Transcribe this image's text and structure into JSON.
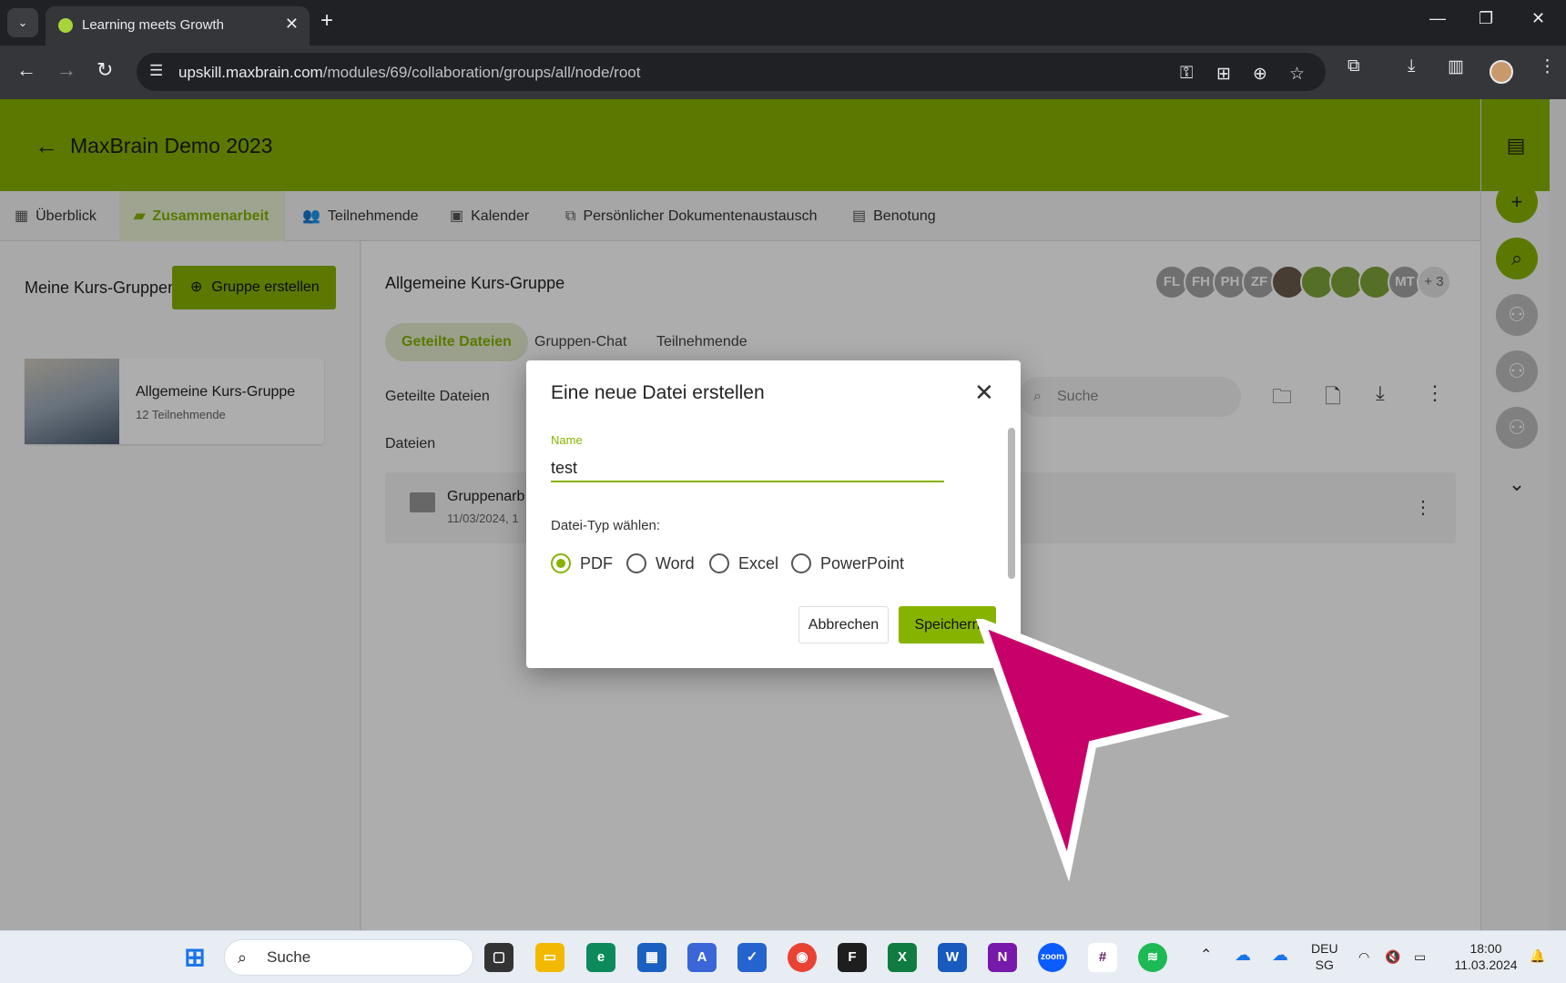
{
  "browser": {
    "tab_title": "Learning meets Growth",
    "url_host": "upskill.maxbrain.com",
    "url_path": "/modules/69/collaboration/groups/all/node/root"
  },
  "app": {
    "course_title": "MaxBrain Demo 2023",
    "nav": [
      {
        "label": "Überblick",
        "icon": "dashboard-icon"
      },
      {
        "label": "Zusammenarbeit",
        "icon": "folder-shared-icon"
      },
      {
        "label": "Teilnehmende",
        "icon": "people-icon"
      },
      {
        "label": "Kalender",
        "icon": "calendar-icon"
      },
      {
        "label": "Persönlicher Dokumentenaustausch",
        "icon": "documents-icon"
      },
      {
        "label": "Benotung",
        "icon": "grade-icon"
      }
    ],
    "left": {
      "title": "Meine Kurs-Gruppen",
      "create_button": "Gruppe erstellen",
      "group_name": "Allgemeine Kurs-Gruppe",
      "group_members": "12 Teilnehmende"
    },
    "main": {
      "group_title": "Allgemeine Kurs-Gruppe",
      "tabs": [
        "Geteilte Dateien",
        "Gruppen-Chat",
        "Teilnehmende"
      ],
      "section_title": "Geteilte Dateien",
      "files_label": "Dateien",
      "search_placeholder": "Suche",
      "row_name": "Gruppenarb",
      "row_date": "11/03/2024, 1"
    },
    "avatars": [
      "FL",
      "FH",
      "PH",
      "ZF",
      "",
      "",
      "",
      "",
      "MT",
      "+ 3"
    ]
  },
  "dialog": {
    "title": "Eine neue Datei erstellen",
    "name_label": "Name",
    "name_value": "test",
    "type_label": "Datei-Typ wählen:",
    "options": [
      "PDF",
      "Word",
      "Excel",
      "PowerPoint"
    ],
    "selected": "PDF",
    "cancel": "Abbrechen",
    "save": "Speichern"
  },
  "taskbar": {
    "search": "Suche",
    "lang": "DEU",
    "region": "SG",
    "time": "18:00",
    "date": "11.03.2024"
  },
  "colors": {
    "accent": "#86b300",
    "cursor": "#c8006a"
  }
}
